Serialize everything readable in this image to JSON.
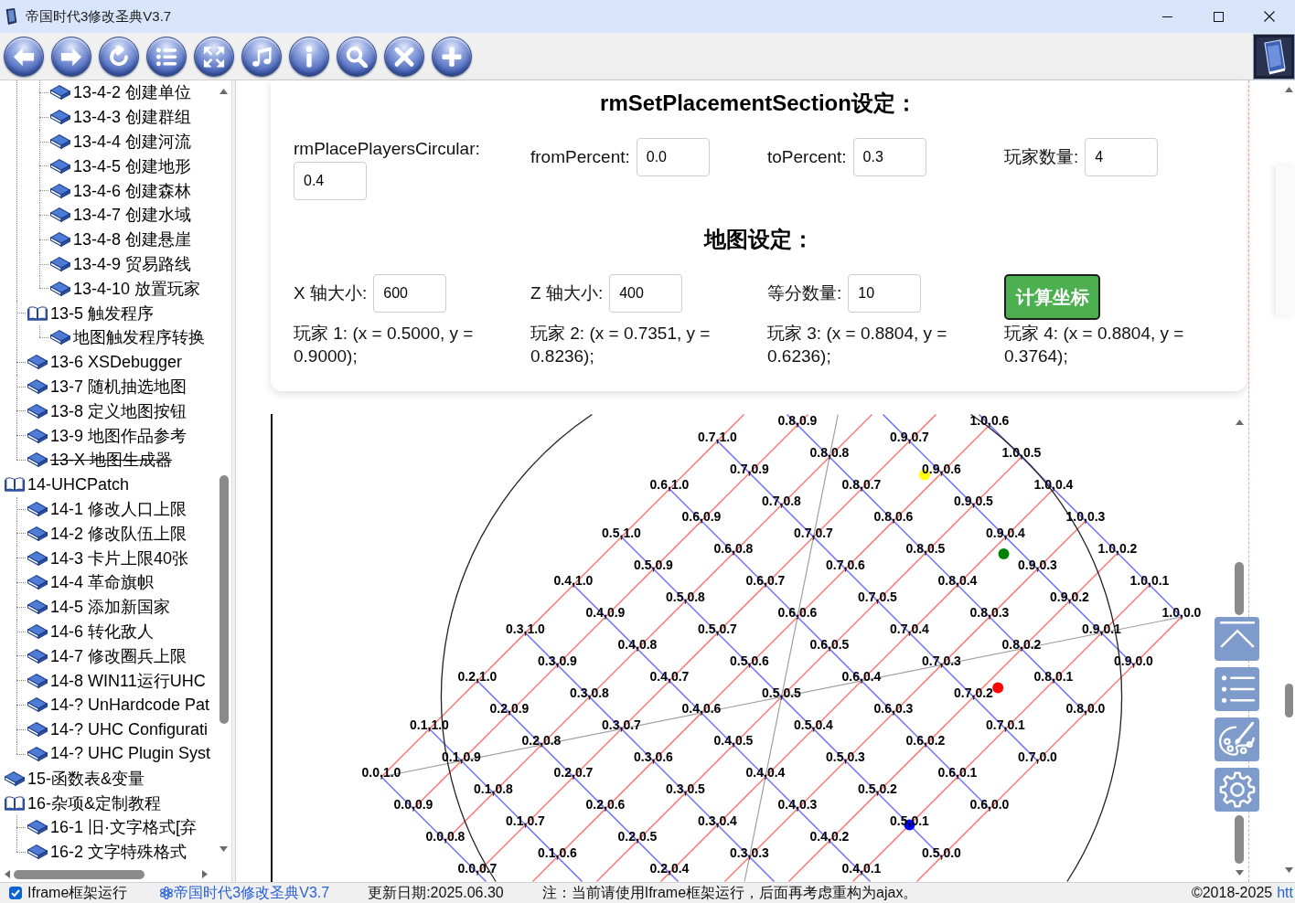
{
  "window": {
    "title": "帝国时代3修改圣典V3.7"
  },
  "toolbar": {
    "buttons": [
      {
        "kind": "back"
      },
      {
        "kind": "forward"
      },
      {
        "kind": "refresh"
      },
      {
        "kind": "list"
      },
      {
        "kind": "fullscreen"
      },
      {
        "kind": "music"
      },
      {
        "kind": "info"
      },
      {
        "kind": "search"
      },
      {
        "kind": "close"
      },
      {
        "kind": "add"
      }
    ]
  },
  "sidebar": {
    "tree": [
      {
        "children": [
          {
            "children": [
              {
                "label": "13-4-2 创建单位",
                "expanded": false,
                "struck": false
              },
              {
                "label": "13-4-3 创建群组",
                "expanded": false,
                "struck": false
              },
              {
                "label": "13-4-4 创建河流",
                "expanded": false,
                "struck": false
              },
              {
                "label": "13-4-5 创建地形",
                "expanded": false,
                "struck": false
              },
              {
                "label": "13-4-6 创建森林",
                "expanded": false,
                "struck": false
              },
              {
                "label": "13-4-7 创建水域",
                "expanded": false,
                "struck": false
              },
              {
                "label": "13-4-8 创建悬崖",
                "expanded": false,
                "struck": false
              },
              {
                "label": "13-4-9 贸易路线",
                "expanded": false,
                "struck": false
              },
              {
                "label": "13-4-10 放置玩家",
                "expanded": false,
                "struck": false
              }
            ]
          },
          {
            "label": "13-5 触发程序",
            "expanded": true,
            "struck": false,
            "children": [
              {
                "label": "地图触发程序转换",
                "expanded": false,
                "struck": false
              }
            ]
          },
          {
            "label": "13-6 XSDebugger",
            "expanded": false,
            "struck": false
          },
          {
            "label": "13-7 随机抽选地图",
            "expanded": false,
            "struck": false
          },
          {
            "label": "13-8 定义地图按钮",
            "expanded": false,
            "struck": false
          },
          {
            "label": "13-9 地图作品参考",
            "expanded": false,
            "struck": false
          },
          {
            "label": "13-X 地图生成器",
            "expanded": false,
            "struck": true
          }
        ]
      },
      {
        "label": "14-UHCPatch",
        "expanded": true,
        "struck": false,
        "children": [
          {
            "label": "14-1 修改人口上限",
            "expanded": false,
            "struck": false
          },
          {
            "label": "14-2 修改队伍上限",
            "expanded": false,
            "struck": false
          },
          {
            "label": "14-3 卡片上限40张",
            "expanded": false,
            "struck": false
          },
          {
            "label": "14-4 革命旗帜",
            "expanded": false,
            "struck": false
          },
          {
            "label": "14-5 添加新国家",
            "expanded": false,
            "struck": false
          },
          {
            "label": "14-6 转化敌人",
            "expanded": false,
            "struck": false
          },
          {
            "label": "14-7 修改圈兵上限",
            "expanded": false,
            "struck": false
          },
          {
            "label": "14-8 WIN11运行UHC",
            "expanded": false,
            "struck": false
          },
          {
            "label": "14-? UnHardcode Pat",
            "expanded": false,
            "struck": false
          },
          {
            "label": "14-? UHC Configurati",
            "expanded": false,
            "struck": false
          },
          {
            "label": "14-? UHC Plugin Syst",
            "expanded": false,
            "struck": false
          }
        ]
      },
      {
        "label": "15-函数表&变量",
        "expanded": false,
        "struck": false
      },
      {
        "label": "16-杂项&定制教程",
        "expanded": true,
        "struck": false,
        "children": [
          {
            "label": "16-1 旧·文字格式[弃",
            "expanded": false,
            "struck": false
          },
          {
            "label": "16-2 文字特殊格式",
            "expanded": false,
            "struck": false
          }
        ]
      }
    ]
  },
  "placement": {
    "title": "rmSetPlacementSection设定：",
    "fields": [
      {
        "label": "rmPlacePlayersCircular:",
        "value": "0.4"
      },
      {
        "label": "fromPercent:",
        "value": "0.0"
      },
      {
        "label": "toPercent:",
        "value": "0.3"
      },
      {
        "label": "玩家数量:",
        "value": "4"
      }
    ]
  },
  "map_settings": {
    "title": "地图设定：",
    "fields": [
      {
        "label": "X 轴大小:",
        "value": "600"
      },
      {
        "label": "Z 轴大小:",
        "value": "400"
      },
      {
        "label": "等分数量:",
        "value": "10"
      }
    ],
    "button": "计算坐标",
    "results": [
      "玩家 1: (x = 0.5000, y = 0.9000);",
      "玩家 2: (x = 0.7351, y = 0.8236);",
      "玩家 3: (x = 0.8804, y = 0.6236);",
      "玩家 4: (x = 0.8804, y = 0.3764);"
    ]
  },
  "diagram": {
    "point_labels": [
      "0.0,0.7",
      "0.0,0.8",
      "0.0,0.9",
      "0.0,1.0",
      "0.1,0.6",
      "0.1,0.7",
      "0.1,0.8",
      "0.1,0.9",
      "0.1,1.0",
      "0.2,0.4",
      "0.2,0.5",
      "0.2,0.6",
      "0.2,0.7",
      "0.2,0.8",
      "0.2,0.9",
      "0.2,1.0",
      "0.3,0.3",
      "0.3,0.4",
      "0.3,0.5",
      "0.3,0.6",
      "0.3,0.7",
      "0.3,0.8",
      "0.3,0.9",
      "0.3,1.0",
      "0.4,0.1",
      "0.4,0.2",
      "0.4,0.3",
      "0.4,0.4",
      "0.4,0.5",
      "0.4,0.6",
      "0.4,0.7",
      "0.4,0.8",
      "0.4,0.9",
      "0.4,1.0",
      "0.5,0.0",
      "0.5,0.1",
      "0.5,0.2",
      "0.5,0.3",
      "0.5,0.4",
      "0.5,0.5",
      "0.5,0.6",
      "0.5,0.7",
      "0.5,0.8",
      "0.5,0.9",
      "0.5,1.0",
      "0.6,0.0",
      "0.6,0.1",
      "0.6,0.2",
      "0.6,0.3",
      "0.6,0.4",
      "0.6,0.5",
      "0.6,0.6",
      "0.6,0.7",
      "0.6,0.8",
      "0.6,0.9",
      "0.6,1.0",
      "0.7,0.0",
      "0.7,0.1",
      "0.7,0.2",
      "0.7,0.3",
      "0.7,0.4",
      "0.7,0.5",
      "0.7,0.6",
      "0.7,0.7",
      "0.7,0.8",
      "0.7,0.9",
      "0.7,1.0",
      "0.8,0.0",
      "0.8,0.1",
      "0.8,0.2",
      "0.8,0.3",
      "0.8,0.4",
      "0.8,0.5",
      "0.8,0.6",
      "0.8,0.7",
      "0.8,0.8",
      "0.8,0.9",
      "0.9,0.0",
      "0.9,0.1",
      "0.9,0.2",
      "0.9,0.3",
      "0.9,0.4",
      "0.9,0.5",
      "0.9,0.6",
      "0.9,0.7",
      "1.0,0.0",
      "1.0,0.1",
      "1.0,0.2",
      "1.0,0.3",
      "1.0,0.4",
      "1.0,0.5",
      "1.0,0.6"
    ],
    "markers": [
      {
        "color": "#0000ff"
      },
      {
        "color": "#ff0000"
      },
      {
        "color": "#008000"
      },
      {
        "color": "#ffff00"
      }
    ]
  },
  "float_buttons": [
    {
      "kind": "top"
    },
    {
      "kind": "list"
    },
    {
      "kind": "palette"
    },
    {
      "kind": "settings"
    }
  ],
  "status_bar": {
    "checkbox": {
      "label": "Iframe框架运行",
      "checked": true
    },
    "site_link": "帝国时代3修改圣典V3.7",
    "update_date": "更新日期:2025.06.30",
    "note": "注：当前请使用Iframe框架运行，后面再考虑重构为ajax。",
    "copyright": "©2018-2025",
    "url_link": "htt"
  }
}
